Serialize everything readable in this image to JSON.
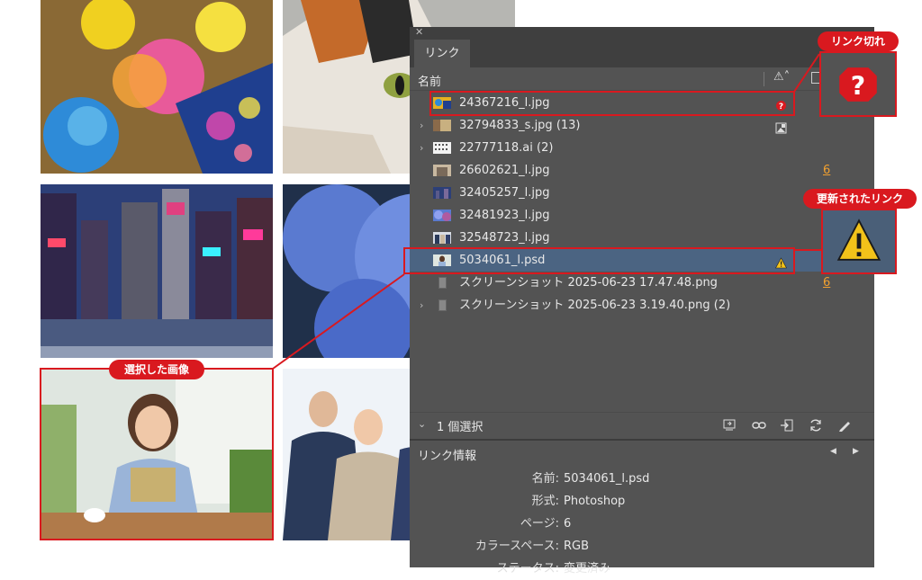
{
  "panel": {
    "tab_label": "リンク",
    "column_name": "名前",
    "links": [
      {
        "label": "24367216_l.jpg",
        "status": "missing-icon",
        "page": ""
      },
      {
        "label": "32794833_s.jpg (13)",
        "status": "embedded-icon",
        "page": ""
      },
      {
        "label": "22777118.ai (2)",
        "status": "",
        "page": ""
      },
      {
        "label": "26602621_l.jpg",
        "status": "",
        "page": "6"
      },
      {
        "label": "32405257_l.jpg",
        "status": "",
        "page": ""
      },
      {
        "label": "32481923_l.jpg",
        "status": "",
        "page": ""
      },
      {
        "label": "32548723_l.jpg",
        "status": "",
        "page": ""
      },
      {
        "label": "5034061_l.psd",
        "status": "modified-icon",
        "page": ""
      },
      {
        "label": "スクリーンショット 2025-06-23 17.47.48.png",
        "status": "",
        "page": "6"
      },
      {
        "label": "スクリーンショット 2025-06-23 3.19.40.png (2)",
        "status": "",
        "page": ""
      }
    ],
    "selection_count": "1 個選択",
    "info_title": "リンク情報",
    "info": [
      {
        "key": "名前:",
        "value": "5034061_l.psd"
      },
      {
        "key": "形式:",
        "value": "Photoshop"
      },
      {
        "key": "ページ:",
        "value": "6"
      },
      {
        "key": "カラースペース:",
        "value": "RGB"
      },
      {
        "key": "ステータス:",
        "value": "変更済み"
      }
    ]
  },
  "callouts": {
    "missing": "リンク切れ",
    "modified": "更新されたリンク",
    "selected": "選択した画像"
  },
  "colors": {
    "accent_red": "#d9191f",
    "panel_bg": "#535353",
    "selection": "#4b6482",
    "page_link": "#f0a030"
  }
}
